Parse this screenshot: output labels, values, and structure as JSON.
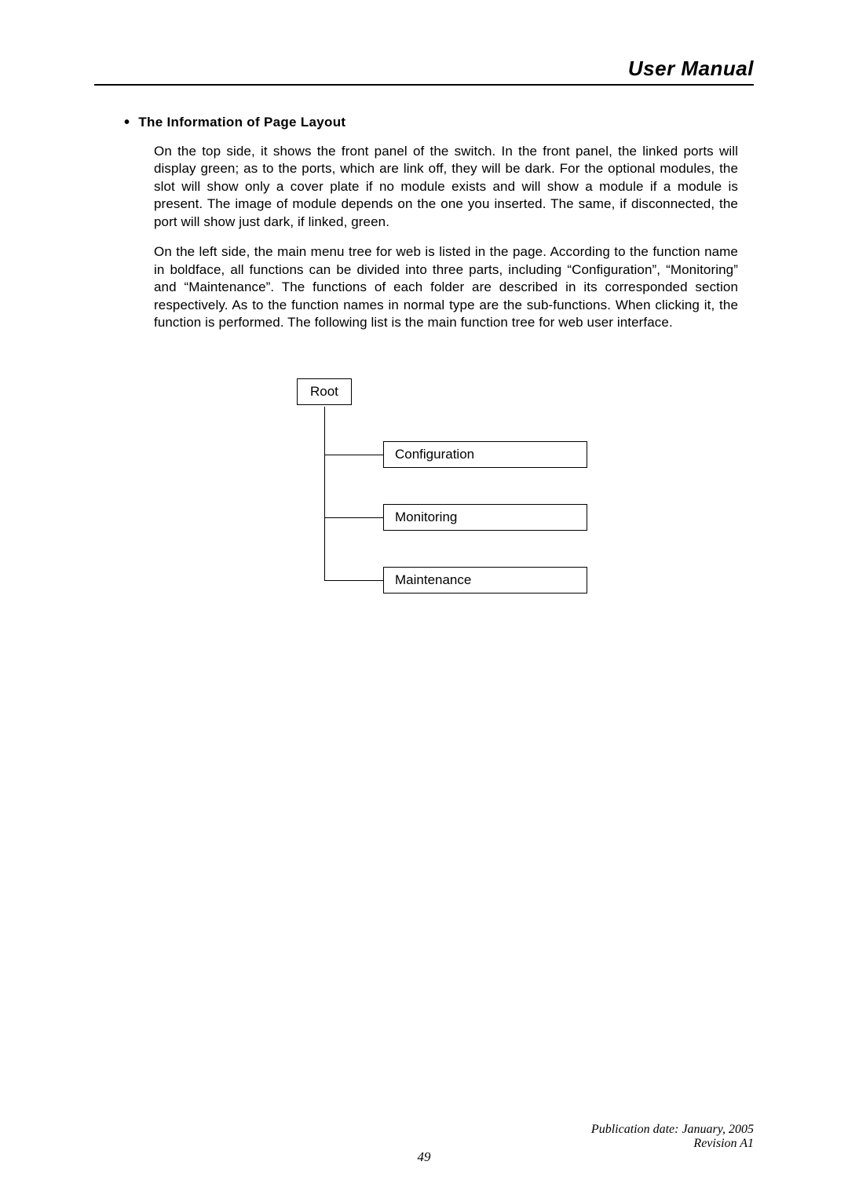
{
  "header": {
    "title": "User Manual"
  },
  "section": {
    "heading": "The Information of Page Layout",
    "paragraph1": "On the top side, it shows the front panel of the switch. In the front panel, the linked ports will display green; as to the ports, which are link off, they will be dark. For the optional modules, the slot will show only a cover plate if no module exists and will show a module if a module is present. The image of module depends on the one you inserted. The same, if disconnected, the port will show just dark, if linked, green.",
    "paragraph2": "On the left side, the main menu tree for web is listed in the page. According to the function name in boldface, all functions can be divided into three parts, including “Configuration”, “Monitoring” and “Maintenance”. The functions of each folder are described in its corresponded section respectively. As to the function names in normal type are the sub-functions. When clicking it, the function is performed. The following list is the main function tree for web user interface."
  },
  "tree": {
    "root": "Root",
    "nodes": [
      "Configuration",
      "Monitoring",
      "Maintenance"
    ]
  },
  "footer": {
    "publication": "Publication date: January, 2005",
    "revision": "Revision A1",
    "pageNumber": "49"
  }
}
